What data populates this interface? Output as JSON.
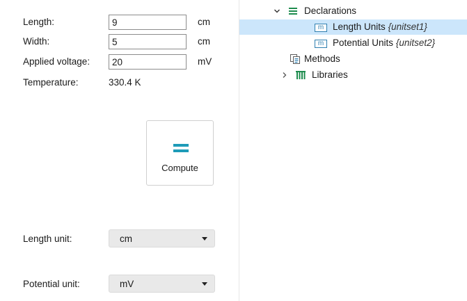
{
  "form": {
    "length": {
      "label": "Length:",
      "value": "9",
      "unit": "cm"
    },
    "width": {
      "label": "Width:",
      "value": "5",
      "unit": "cm"
    },
    "voltage": {
      "label": "Applied voltage:",
      "value": "20",
      "unit": "mV"
    },
    "temperature": {
      "label": "Temperature:",
      "value": "330.4 K"
    },
    "compute": {
      "label": "Compute",
      "icon": "equals-icon"
    },
    "length_unit": {
      "label": "Length unit:",
      "selected": "cm"
    },
    "potential_unit": {
      "label": "Potential unit:",
      "selected": "mV"
    }
  },
  "tree": {
    "declarations": {
      "label": "Declarations",
      "expanded": true,
      "icon": "list-icon"
    },
    "length_units": {
      "icon_text": "m",
      "label": "Length Units",
      "tag": "{unitset1}",
      "selected": true
    },
    "potential_units": {
      "icon_text": "m",
      "label": "Potential Units",
      "tag": "{unitset2}"
    },
    "methods": {
      "label": "Methods",
      "icon": "methods-icon"
    },
    "libraries": {
      "label": "Libraries",
      "expanded": false,
      "icon": "library-icon"
    }
  },
  "colors": {
    "accent": "#1e9bb8",
    "selection": "#cce6fb",
    "combo_bg": "#e9e9e9"
  }
}
